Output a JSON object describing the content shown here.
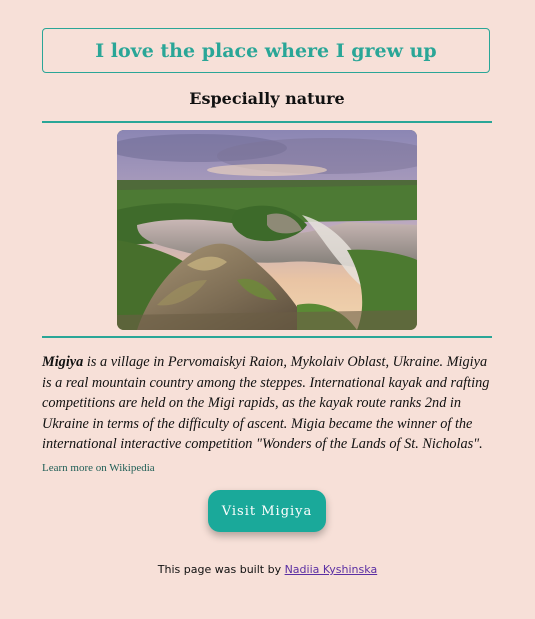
{
  "header": {
    "title": "I love the place where I grew up",
    "subtitle": "Especially nature"
  },
  "main": {
    "image_icon": "landscape-photo",
    "description": {
      "bold_lead": "Migiya",
      "text": " is a village in Pervomaiskyi Raion, Mykolaiv Oblast, Ukraine. Migiya is a real mountain country among the steppes. International kayak and rafting competitions are held on the Migi rapids, as the kayak route ranks 2nd in Ukraine in terms of the difficulty of ascent. Migia became the winner of the international interactive competition \"Wonders of the Lands of St. Nicholas\"."
    },
    "wiki_link": "Learn more on Wikipedia",
    "visit_button": "Visit Migiya"
  },
  "footer": {
    "prefix": "This page was built by ",
    "author": "Nadiia Kyshinska"
  },
  "colors": {
    "background": "#f7e0d8",
    "accent": "#2aa697",
    "button": "#1aa99a",
    "author_link": "#5b2fa3"
  }
}
